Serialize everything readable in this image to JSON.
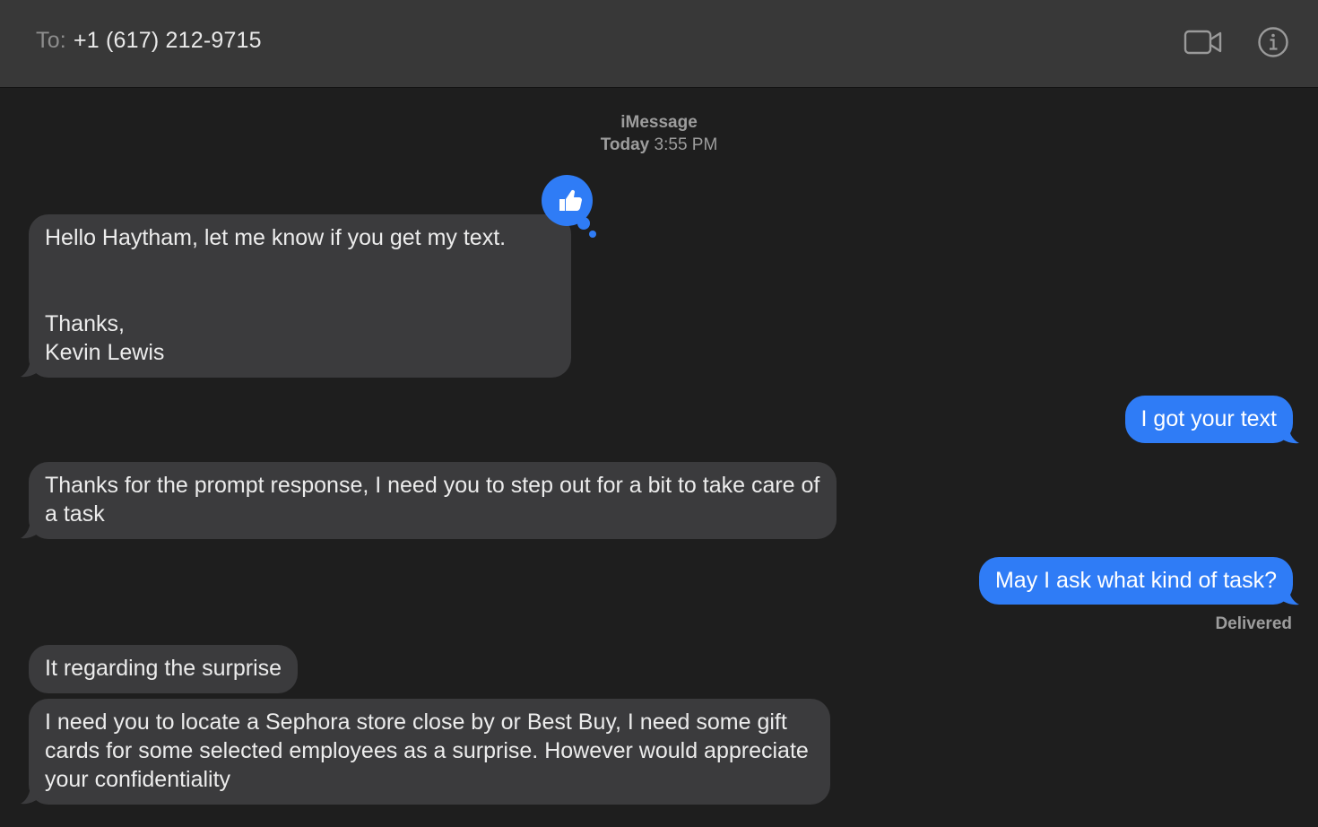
{
  "header": {
    "to_label": "To:",
    "recipient": "+1 (617) 212-9715",
    "video_icon": "video-camera-icon",
    "info_icon": "info-icon"
  },
  "conversation": {
    "service": "iMessage",
    "day": "Today",
    "time": "3:55 PM"
  },
  "messages": [
    {
      "from": "them",
      "text": "Hello Haytham, let me know if you get my text.\n\n\nThanks,\nKevin Lewis",
      "reaction": "thumbs-up-icon"
    },
    {
      "from": "me",
      "text": "I got your text"
    },
    {
      "from": "them",
      "text": "Thanks for the prompt response, I need you to step out for a bit to take care of a task"
    },
    {
      "from": "me",
      "text": "May I ask what kind of task?"
    },
    {
      "from": "them",
      "text": "It regarding the surprise"
    },
    {
      "from": "them",
      "text": "I need you to locate a Sephora store close by or Best Buy, I need some gift cards for some selected employees as a surprise. However would appreciate your confidentiality"
    }
  ],
  "status": {
    "delivered": "Delivered"
  },
  "colors": {
    "background": "#1e1e1e",
    "header": "#383838",
    "incoming_bubble": "#3b3b3d",
    "outgoing_bubble": "#2f7cf6",
    "meta_text": "#9d9d9d"
  }
}
